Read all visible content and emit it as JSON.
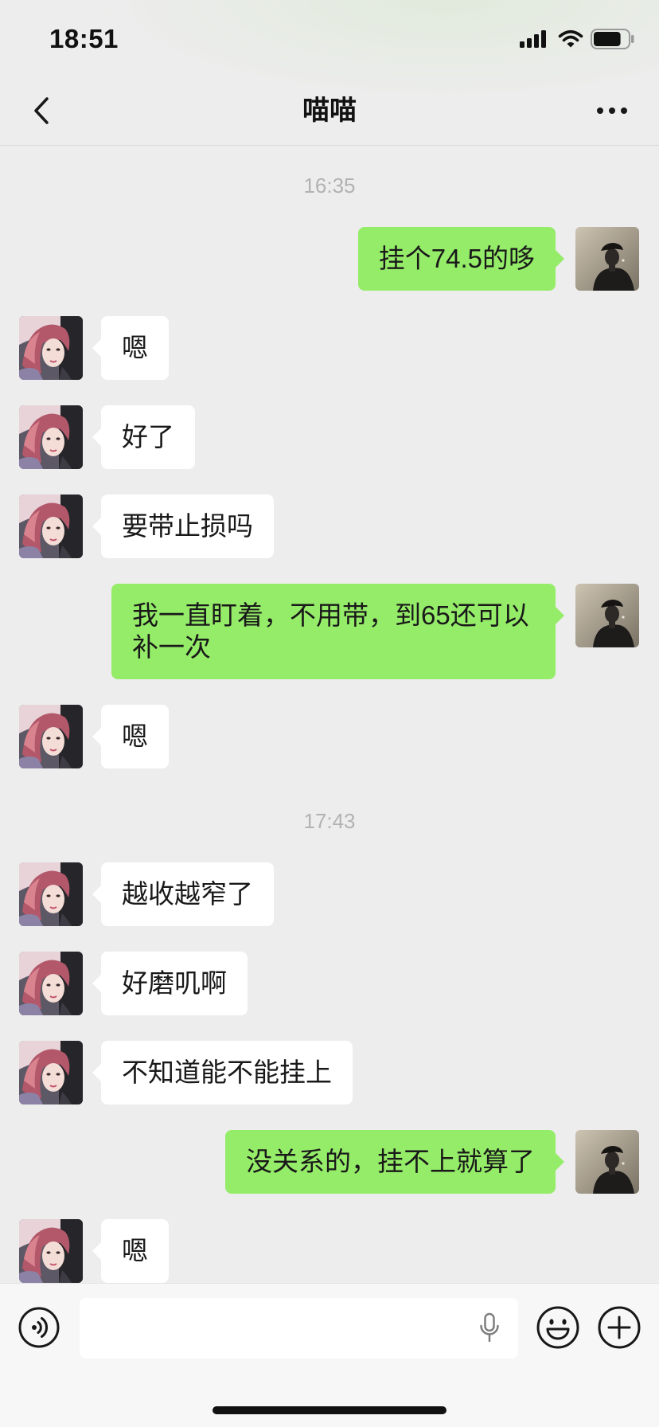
{
  "status_bar": {
    "time": "18:51",
    "icons": [
      "signal-icon",
      "wifi-icon",
      "battery-icon"
    ],
    "battery_level": 0.8
  },
  "nav": {
    "title": "喵喵",
    "back_icon": "chevron-left-icon",
    "more_icon": "more-icon"
  },
  "chat": {
    "items": [
      {
        "timestamp": "16:35"
      },
      {
        "outgoing": true,
        "text": "挂个74.5的哆"
      },
      {
        "outgoing": false,
        "text": "嗯"
      },
      {
        "outgoing": false,
        "text": "好了"
      },
      {
        "outgoing": false,
        "text": "要带止损吗"
      },
      {
        "outgoing": true,
        "text": "我一直盯着，不用带，到65还可以补一次"
      },
      {
        "outgoing": false,
        "text": "嗯"
      },
      {
        "timestamp": "17:43"
      },
      {
        "outgoing": false,
        "text": "越收越窄了"
      },
      {
        "outgoing": false,
        "text": "好磨叽啊"
      },
      {
        "outgoing": false,
        "text": "不知道能不能挂上"
      },
      {
        "outgoing": true,
        "text": "没关系的，挂不上就算了"
      },
      {
        "outgoing": false,
        "text": "嗯"
      }
    ]
  },
  "input_bar": {
    "value": "",
    "icons": [
      "voice-icon",
      "microphone-icon",
      "emoji-icon",
      "plus-icon"
    ]
  },
  "colors": {
    "background": "#EDEDED",
    "outgoing_bubble": "#95EC69",
    "incoming_bubble": "#FFFFFF",
    "text": "#191919",
    "timestamp": "#B2B2B2"
  }
}
